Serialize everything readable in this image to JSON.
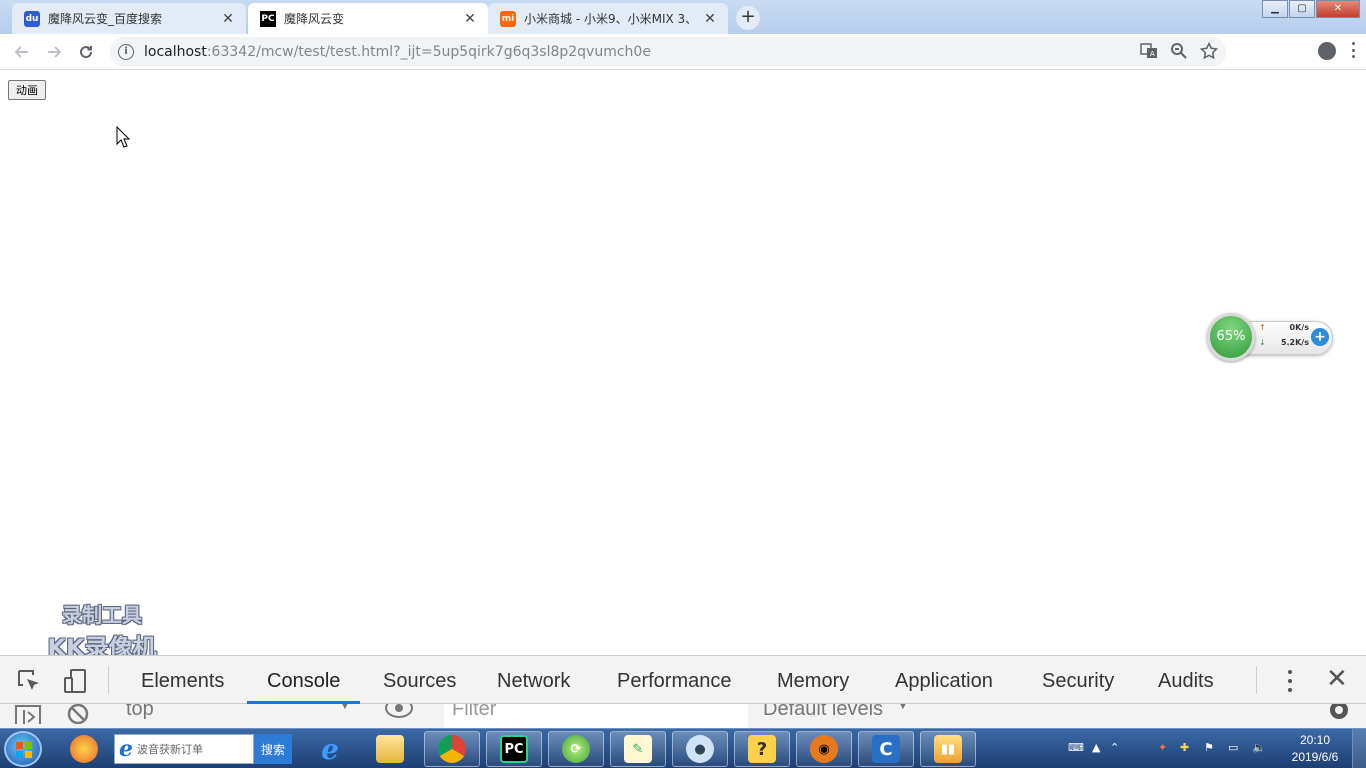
{
  "browser": {
    "tabs": [
      {
        "title": "魔降风云变_百度搜索",
        "favicon": "baidu-icon",
        "active": false
      },
      {
        "title": "魔降风云变",
        "favicon": "pycharm-icon",
        "active": true
      },
      {
        "title": "小米商城 - 小米9、小米MIX 3、",
        "favicon": "mi-icon",
        "active": false
      }
    ],
    "window_controls": {
      "minimize": "▁",
      "maximize": "▢",
      "close": "✕"
    },
    "url_host": "localhost",
    "url_rest": ":63342/mcw/test/test.html?_ijt=5up5qirk7g6q3sl8p2qvumch0e"
  },
  "page": {
    "button_label": "动画"
  },
  "net_widget": {
    "percent": "65%",
    "upload": "0K/s",
    "download": "5.2K/s"
  },
  "watermark": {
    "line1": "录制工具",
    "line2": "KK录像机"
  },
  "devtools": {
    "tabs": [
      "Elements",
      "Console",
      "Sources",
      "Network",
      "Performance",
      "Memory",
      "Application",
      "Security",
      "Audits"
    ],
    "active_tab": "Console",
    "context": "top",
    "filter_placeholder": "Filter",
    "levels": "Default levels"
  },
  "taskbar": {
    "search_placeholder": "波音获新订单",
    "search_button": "搜索",
    "clock_time": "20:10",
    "clock_date": "2019/6/6"
  },
  "colors": {
    "accent": "#1a73e8",
    "taskbar": "#1d3f73",
    "tab_strip": "#c9dbf1"
  }
}
